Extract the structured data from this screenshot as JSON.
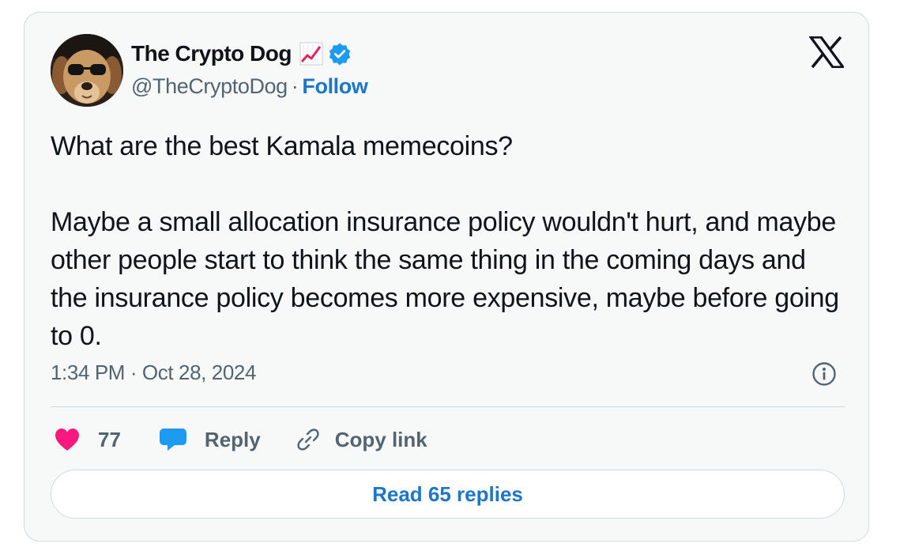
{
  "author": {
    "display_name": "The Crypto Dog",
    "handle": "@TheCryptoDog",
    "separator": "·",
    "follow_label": "Follow",
    "verified_color": "#1d9bf0",
    "avatar_icon": "dog-with-sunglasses-avatar",
    "name_emoji": "chart-increasing-emoji"
  },
  "tweet": {
    "paragraphs": [
      "What are the best Kamala memecoins?",
      "Maybe a small allocation insurance policy wouldn't hurt, and maybe other people start to think the same thing in the coming days and the insurance policy becomes more expensive, maybe before going to 0."
    ],
    "timestamp": "1:34 PM · Oct 28, 2024"
  },
  "actions": {
    "like_count": "77",
    "reply_label": "Reply",
    "copy_link_label": "Copy link",
    "read_replies_label": "Read 65 replies"
  },
  "colors": {
    "like": "#f91880",
    "reply": "#1d9bf0",
    "link": "#1d76c8",
    "text": "#0f1419",
    "muted": "#536471"
  }
}
